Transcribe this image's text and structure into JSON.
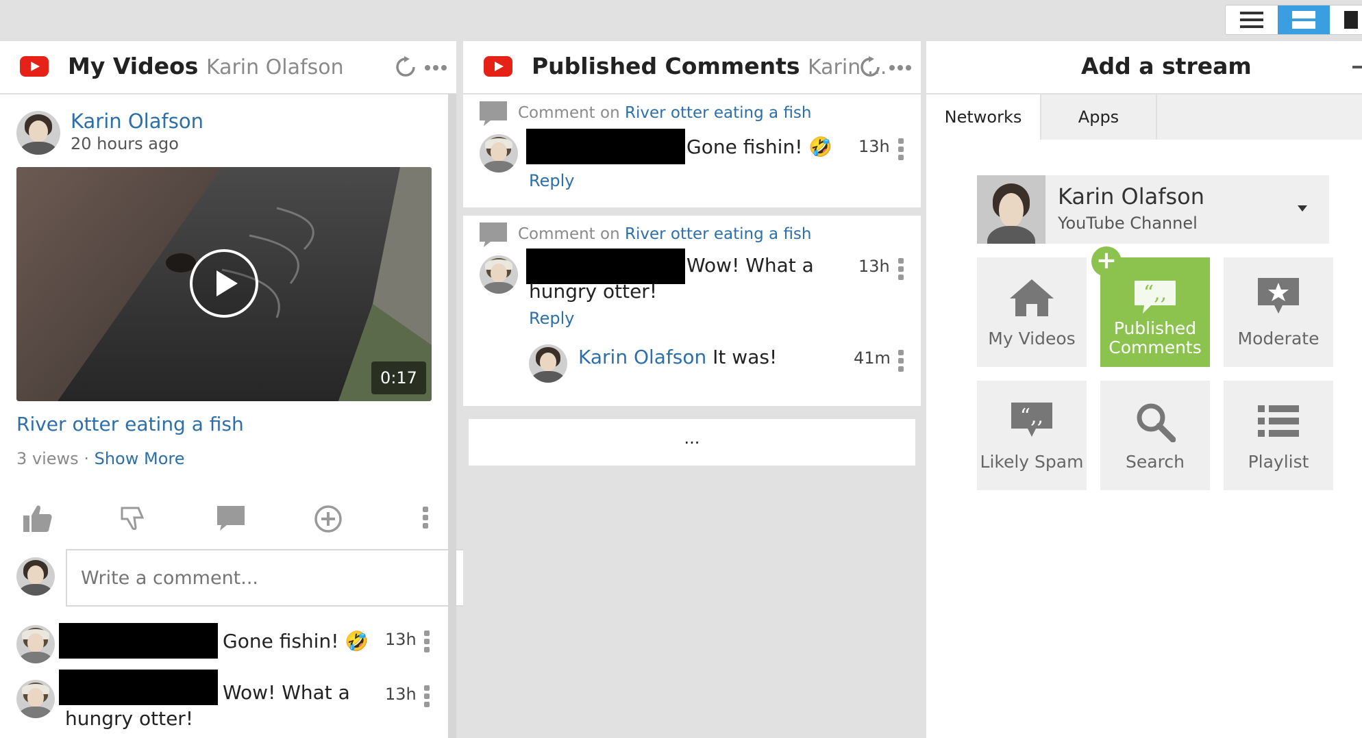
{
  "topbar": {
    "view_buttons": [
      "list-view",
      "stream-view",
      "column-view"
    ]
  },
  "col1": {
    "network_icon": "youtube-icon",
    "title": "My Videos",
    "subtitle": "Karin Olafson",
    "post": {
      "author": "Karin Olafson",
      "time": "20 hours ago",
      "duration": "0:17",
      "video_title": "River otter eating a fish",
      "views": "3 views",
      "separator": "·",
      "show_more": "Show More"
    },
    "comment_placeholder": "Write a comment...",
    "comments": [
      {
        "text": "Gone fishin! 🤣",
        "time": "13h"
      },
      {
        "text_line1": "Wow! What a",
        "text_line2": "hungry otter!",
        "time": "13h"
      }
    ]
  },
  "col2": {
    "network_icon": "youtube-icon",
    "title": "Published Comments",
    "subtitle": "Karin ...",
    "cards": [
      {
        "comment_on": "Comment on",
        "video": "River otter eating a fish",
        "text": "Gone fishin! 🤣",
        "time": "13h",
        "reply": "Reply"
      },
      {
        "comment_on": "Comment on",
        "video": "River otter eating a fish",
        "text_line1": "Wow! What a",
        "text_line2": "hungry otter!",
        "time": "13h",
        "reply": "Reply",
        "sub_reply": {
          "author": "Karin Olafson",
          "text": "It was!",
          "time": "41m"
        }
      }
    ],
    "load_more": "..."
  },
  "col3": {
    "title": "Add a stream",
    "tabs": [
      "Networks",
      "Apps"
    ],
    "account": {
      "name": "Karin Olafson",
      "type": "YouTube Channel"
    },
    "streams": [
      {
        "label": "My Videos",
        "icon": "home-icon"
      },
      {
        "label_line1": "Published",
        "label_line2": "Comments",
        "icon": "quote-icon",
        "active": true
      },
      {
        "label": "Moderate",
        "icon": "star-bubble-icon"
      },
      {
        "label": "Likely Spam",
        "icon": "quote-bubble-icon"
      },
      {
        "label": "Search",
        "icon": "search-icon"
      },
      {
        "label": "Playlist",
        "icon": "list-icon"
      }
    ],
    "active_color": "#8cc34f"
  },
  "colors": {
    "link": "#2d6fa8",
    "youtube_red": "#e62117",
    "toggle_active": "#3a9fe0"
  }
}
